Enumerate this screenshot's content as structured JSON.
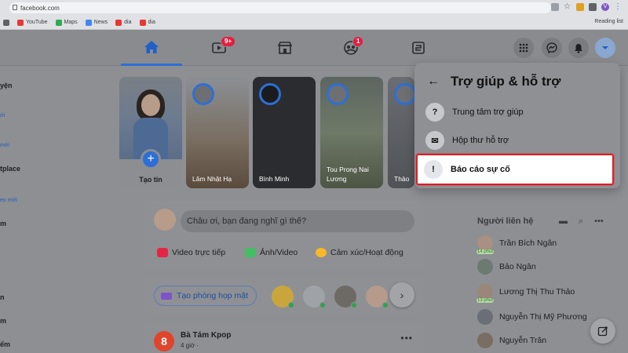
{
  "browser": {
    "url": "facebook.com",
    "bookmarks": [
      "YouTube",
      "Maps",
      "News",
      "dia",
      "dia"
    ],
    "reading_list": "Reading list"
  },
  "nav": {
    "watch_badge": "9+",
    "groups_badge": "1"
  },
  "sidebar": {
    "items": [
      {
        "label": "yện",
        "small": false
      },
      {
        "label": "ới",
        "small": true
      },
      {
        "label": "mới",
        "small": true
      },
      {
        "label": "tplace",
        "small": false
      },
      {
        "label": "eo mới",
        "small": true
      },
      {
        "label": "m",
        "small": false
      },
      {
        "label": "n",
        "small": false
      },
      {
        "label": "m",
        "small": false
      },
      {
        "label": "ểm",
        "small": false
      }
    ]
  },
  "stories": {
    "create_label": "Tạo tin",
    "items": [
      {
        "name": "Lâm Nhật Hạ"
      },
      {
        "name": "Bình Minh"
      },
      {
        "name": "Tou Prong Nai Lương"
      },
      {
        "name": "Thảo"
      }
    ]
  },
  "composer": {
    "placeholder": "Châu ơi, bạn đang nghĩ gì thế?",
    "actions": [
      "Video trực tiếp",
      "Ảnh/Video",
      "Cảm xúc/Hoạt động"
    ]
  },
  "rooms": {
    "button_label": "Tạo phòng họp mặt"
  },
  "post": {
    "author": "Bà Tám Kpop",
    "time": "4 giờ ·",
    "avatar_letter": "8"
  },
  "help_menu": {
    "title": "Trợ giúp & hỗ trợ",
    "items": [
      {
        "label": "Trung tâm trợ giúp",
        "icon": "?"
      },
      {
        "label": "Hộp thư hỗ trợ",
        "icon": "✉"
      },
      {
        "label": "Báo cáo sự cố",
        "icon": "!"
      }
    ]
  },
  "contacts": {
    "title": "Người liên hệ",
    "list": [
      {
        "name": "Trần Bích Ngân",
        "mins": "14 phút"
      },
      {
        "name": "Bảo Ngân",
        "mins": ""
      },
      {
        "name": "Lương Thị Thu Thảo",
        "mins": "13 phút"
      },
      {
        "name": "Nguyễn Thị Mỹ Phương",
        "mins": ""
      },
      {
        "name": "Nguyễn Trân",
        "mins": ""
      }
    ]
  },
  "colors": {
    "accent": "#2d6fd6",
    "highlight_border": "#e11b22",
    "badge": "#e41e3f"
  }
}
